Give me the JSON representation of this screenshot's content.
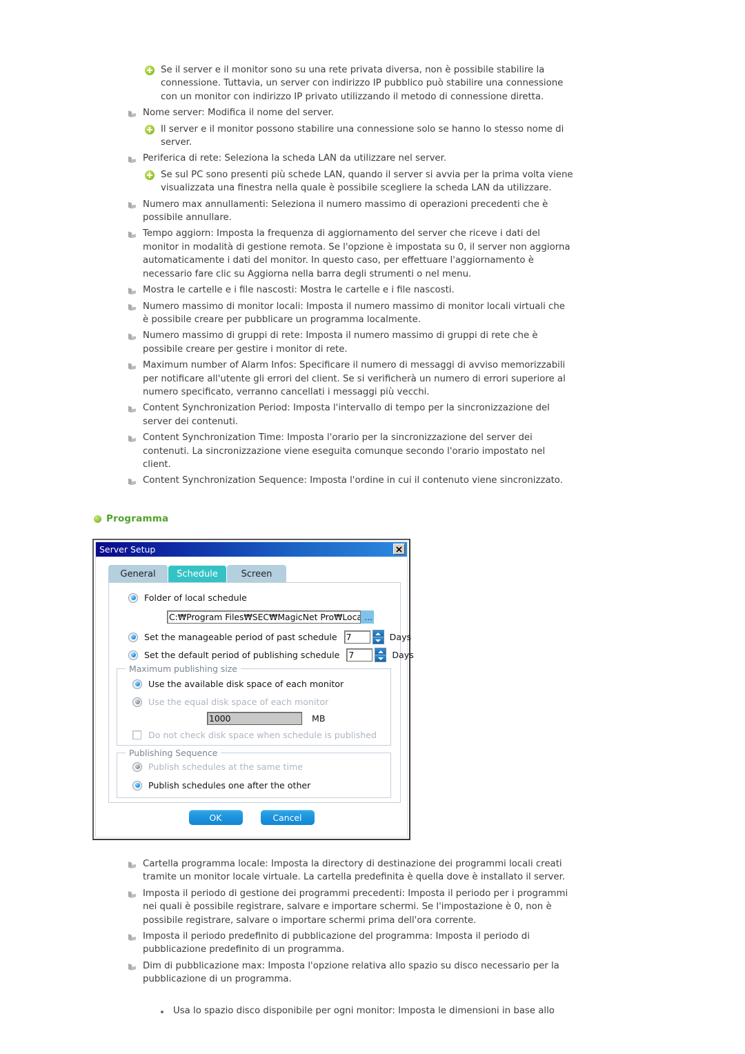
{
  "doc": {
    "top_blocks": [
      {
        "level": 2,
        "text": "Se il server e il monitor sono su una rete privata diversa, non è possibile stabilire la connessione. Tuttavia, un server con indirizzo IP pubblico può stabilire una connessione con un monitor con indirizzo IP privato utilizzando il metodo di connessione diretta."
      },
      {
        "level": 1,
        "text": "Nome server: Modifica il nome del server."
      },
      {
        "level": 2,
        "text": "Il server e il monitor possono stabilire una connessione solo se hanno lo stesso nome di server."
      },
      {
        "level": 1,
        "text": "Periferica di rete: Seleziona la scheda LAN da utilizzare nel server."
      },
      {
        "level": 2,
        "text": "Se sul PC sono presenti più schede LAN, quando il server si avvia per la prima volta viene visualizzata una finestra nella quale è possibile scegliere la scheda LAN da utilizzare."
      },
      {
        "level": 1,
        "text": "Numero max annullamenti: Seleziona il numero massimo di operazioni precedenti che è possibile annullare."
      },
      {
        "level": 1,
        "text": "Tempo aggiorn: Imposta la frequenza di aggiornamento del server che riceve i dati del monitor in modalità di gestione remota. Se l'opzione è impostata su 0, il server non aggiorna automaticamente i dati del monitor. In questo caso, per effettuare l'aggiornamento è necessario fare clic su Aggiorna nella barra degli strumenti o nel menu."
      },
      {
        "level": 1,
        "text": "Mostra le cartelle e i file nascosti: Mostra le cartelle e i file nascosti."
      },
      {
        "level": 1,
        "text": "Numero massimo di monitor locali: Imposta il numero massimo di monitor locali virtuali che è possibile creare per pubblicare un programma localmente."
      },
      {
        "level": 1,
        "text": "Numero massimo di gruppi di rete: Imposta il numero massimo di gruppi di rete che è possibile creare per gestire i monitor di rete."
      },
      {
        "level": 1,
        "text": "Maximum number of Alarm Infos: Specificare il numero di messaggi di avviso memorizzabili per notificare all'utente gli errori del client. Se si verificherà un numero di errori superiore al numero specificato, verranno cancellati i messaggi più vecchi."
      },
      {
        "level": 1,
        "text": "Content Synchronization Period: Imposta l'intervallo di tempo per la sincronizzazione del server dei contenuti."
      },
      {
        "level": 1,
        "text": "Content Synchronization Time: Imposta l'orario per la sincronizzazione del server dei contenuti. La sincronizzazione viene eseguita comunque secondo l'orario impostato nel client."
      },
      {
        "level": 1,
        "text": "Content Synchronization Sequence: Imposta l'ordine in cui il contenuto viene sincronizzato."
      }
    ],
    "bottom_blocks": [
      {
        "level": 1,
        "text": "Cartella programma locale: Imposta la directory di destinazione dei programmi locali creati tramite un monitor locale virtuale. La cartella predefinita è quella dove è installato il server."
      },
      {
        "level": 1,
        "text": "Imposta il periodo di gestione dei programmi precedenti: Imposta il periodo per i programmi nei quali è possibile registrare, salvare e importare schermi. Se l'impostazione è 0, non è possibile registrare, salvare o importare schermi prima dell'ora corrente."
      },
      {
        "level": 1,
        "text": "Imposta il periodo predefinito di pubblicazione del programma: Imposta il periodo di pubblicazione predefinito di un programma."
      },
      {
        "level": 1,
        "text": "Dim di pubblicazione max: Imposta l'opzione relativa allo spazio su disco necessario per la pubblicazione di un programma."
      },
      {
        "level": 3,
        "text": "Usa lo spazio disco disponibile per ogni monitor: Imposta le dimensioni in base allo"
      }
    ]
  },
  "section": {
    "heading": "Programma",
    "heading_color": "#4fa22a",
    "bullet_icon": "green-dot-icon"
  },
  "dialog": {
    "title": "Server Setup",
    "close_icon": "close-icon",
    "tabs": [
      {
        "label": "General",
        "active": false
      },
      {
        "label": "Schedule",
        "active": true
      },
      {
        "label": "Screen",
        "active": false
      }
    ],
    "accent_active_tab": "#35c2c4",
    "accent_button": "#1d95dd",
    "options": {
      "folder_label": "Folder of local schedule",
      "folder_value": "C:₩Program Files₩SEC₩MagicNet Pro₩LocalPub",
      "browse_label": "...",
      "past_period_label": "Set the manageable period of past schedule",
      "past_period_value": "7",
      "past_period_unit": "Days",
      "default_period_label": "Set the default period of publishing schedule",
      "default_period_value": "7",
      "default_period_unit": "Days"
    },
    "max_publishing": {
      "group_label": "Maximum publishing size",
      "radio_available": "Use the available disk space of each monitor",
      "radio_equal": "Use the equal disk space of each monitor",
      "size_value": "1000",
      "size_unit": "MB",
      "checkbox_label": "Do not check disk space when schedule is published"
    },
    "publishing_sequence": {
      "group_label": "Publishing Sequence",
      "radio_same_time": "Publish schedules at the same time",
      "radio_one_after": "Publish schedules one after the other"
    },
    "buttons": {
      "ok": "OK",
      "cancel": "Cancel"
    }
  }
}
